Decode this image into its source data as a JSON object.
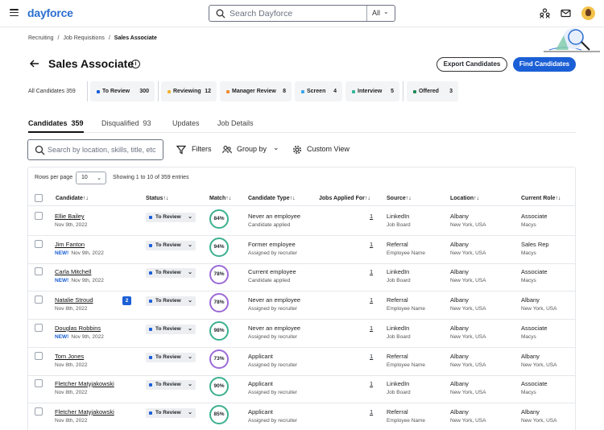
{
  "topbar": {
    "logo": "dayforce",
    "search_placeholder": "Search Dayforce",
    "search_scope": "All"
  },
  "breadcrumb": [
    "Recruiting",
    "Job Requisitions",
    "Sales Associate"
  ],
  "header": {
    "title": "Sales Associate",
    "export_label": "Export Candidates",
    "find_label": "Find Candidates"
  },
  "pipeline": {
    "all_label": "All Candidates 359",
    "stages": [
      {
        "label": "To Review",
        "count": "300",
        "color": "#1b5fd6"
      },
      {
        "label": "Reviewing",
        "count": "12",
        "color": "#f2b233"
      },
      {
        "label": "Manager Review",
        "count": "8",
        "color": "#f08c2e"
      },
      {
        "label": "Screen",
        "count": "4",
        "color": "#3aa5e8"
      },
      {
        "label": "Interview",
        "count": "5",
        "color": "#35b59a"
      },
      {
        "label": "Offered",
        "count": "3",
        "color": "#1f8a5a"
      }
    ]
  },
  "tabs": [
    {
      "label": "Candidates",
      "count": "359"
    },
    {
      "label": "Disqualified",
      "count": "93"
    },
    {
      "label": "Updates",
      "count": ""
    },
    {
      "label": "Job Details",
      "count": ""
    }
  ],
  "filters": {
    "search_placeholder": "Search by location, skills, title, etc",
    "filters_label": "Filters",
    "group_by_label": "Group by",
    "custom_view_label": "Custom View"
  },
  "table": {
    "rows_per_page_label": "Rows per page",
    "rows_per_page_value": "10",
    "showing": "Showing 1 to 10 of 359 entries",
    "headers": [
      "Candidate",
      "Status",
      "Match",
      "Candidate Type",
      "Jobs Applied For",
      "Source",
      "Location",
      "Current Role"
    ],
    "sort_glyph": "↑↓",
    "new_label": "NEW!",
    "rows": [
      {
        "name": "Ellie Bailey",
        "new": false,
        "date": "Nov 9th, 2022",
        "badge": "",
        "status": "To Review",
        "match": "84%",
        "type": "Never an employee",
        "type_sub": "Candidate applied",
        "jobs": "1",
        "source": "LinkedIn",
        "source_sub": "Job Board",
        "city": "Albany",
        "region": "New York, USA",
        "role": "Associate",
        "company": "Macys"
      },
      {
        "name": "Jim Fanton",
        "new": true,
        "date": "Nov 9th, 2022",
        "badge": "",
        "status": "To Review",
        "match": "94%",
        "type": "Former employee",
        "type_sub": "Assigned by recruiter",
        "jobs": "1",
        "source": "Referral",
        "source_sub": "Employee Name",
        "city": "Albany",
        "region": "New York, USA",
        "role": "Sales Rep",
        "company": "Macys"
      },
      {
        "name": "Carla Mitchell",
        "new": true,
        "date": "Nov 9th, 2022",
        "badge": "",
        "status": "To Review",
        "match": "78%",
        "type": "Current employee",
        "type_sub": "Candidate applied",
        "jobs": "1",
        "source": "LinkedIn",
        "source_sub": "Job Board",
        "city": "Albany",
        "region": "New York, USA",
        "role": "Associate",
        "company": "Macys"
      },
      {
        "name": "Natalie Stroud",
        "new": false,
        "date": "Nov 8th, 2022",
        "badge": "2",
        "status": "To Review",
        "match": "78%",
        "type": "Never an employee",
        "type_sub": "Assigned by recruiter",
        "jobs": "1",
        "source": "Referral",
        "source_sub": "Employee Name",
        "city": "Albany",
        "region": "New York, USA",
        "role": "Albany",
        "company": "New York, USA"
      },
      {
        "name": "Douglas Robbins",
        "new": true,
        "date": "Nov 9th, 2022",
        "badge": "",
        "status": "To Review",
        "match": "98%",
        "type": "Never an employee",
        "type_sub": "Assigned by recruiter",
        "jobs": "1",
        "source": "LinkedIn",
        "source_sub": "Job Board",
        "city": "Albany",
        "region": "New York, USA",
        "role": "Associate",
        "company": "Macys"
      },
      {
        "name": "Tom Jones",
        "new": false,
        "date": "Nov 8th, 2022",
        "badge": "",
        "status": "To Review",
        "match": "73%",
        "type": "Applicant",
        "type_sub": "Assigned by recruiter",
        "jobs": "1",
        "source": "Referral",
        "source_sub": "Employee Name",
        "city": "Albany",
        "region": "New York, USA",
        "role": "Albany",
        "company": "New York, USA"
      },
      {
        "name": "Fletcher Matyjakowski",
        "new": false,
        "date": "Nov 8th, 2022",
        "badge": "",
        "status": "To Review",
        "match": "90%",
        "type": "Applicant",
        "type_sub": "Assigned by recruiter",
        "jobs": "1",
        "source": "LinkedIn",
        "source_sub": "Job Board",
        "city": "Albany",
        "region": "New York, USA",
        "role": "Associate",
        "company": "Macys"
      },
      {
        "name": "Fletcher Matyjakowski",
        "new": false,
        "date": "Nov 8th, 2022",
        "badge": "",
        "status": "To Review",
        "match": "85%",
        "type": "Applicant",
        "type_sub": "Assigned by recruiter",
        "jobs": "1",
        "source": "Referral",
        "source_sub": "Employee Name",
        "city": "Albany",
        "region": "New York, USA",
        "role": "Albany",
        "company": "New York, USA"
      }
    ]
  }
}
